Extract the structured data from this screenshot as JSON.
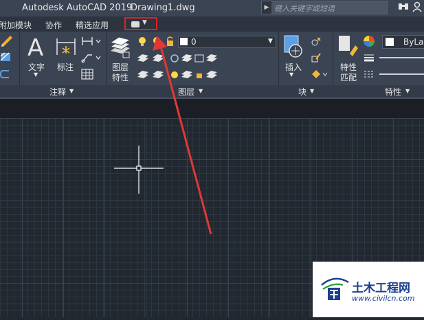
{
  "titlebar": {
    "app_name": "Autodesk AutoCAD 2019",
    "document": "Drawing1.dwg",
    "search_placeholder": "键入关键字或短语"
  },
  "ribbon_tabs": [
    "附加模块",
    "协作",
    "精选应用"
  ],
  "panels": {
    "annotate": {
      "title": "注释",
      "text_label": "文字",
      "dimension_label": "标注"
    },
    "layers": {
      "title": "图层",
      "layer_properties_label_1": "图层",
      "layer_properties_label_2": "特性",
      "current_layer": "0"
    },
    "block": {
      "title": "块",
      "insert_label": "插入"
    },
    "properties": {
      "title": "特性",
      "match_label_1": "特性",
      "match_label_2": "匹配",
      "color_value": "ByLay"
    }
  },
  "watermark": {
    "site_name": "土木工程网",
    "url": "www.civilcn.com"
  },
  "colors": {
    "highlight_box": "#e02020",
    "annotation_arrow": "#e03838",
    "canvas_bg": "#212830"
  },
  "icons": {
    "help": "binoculars-icon",
    "user": "user-icon"
  }
}
